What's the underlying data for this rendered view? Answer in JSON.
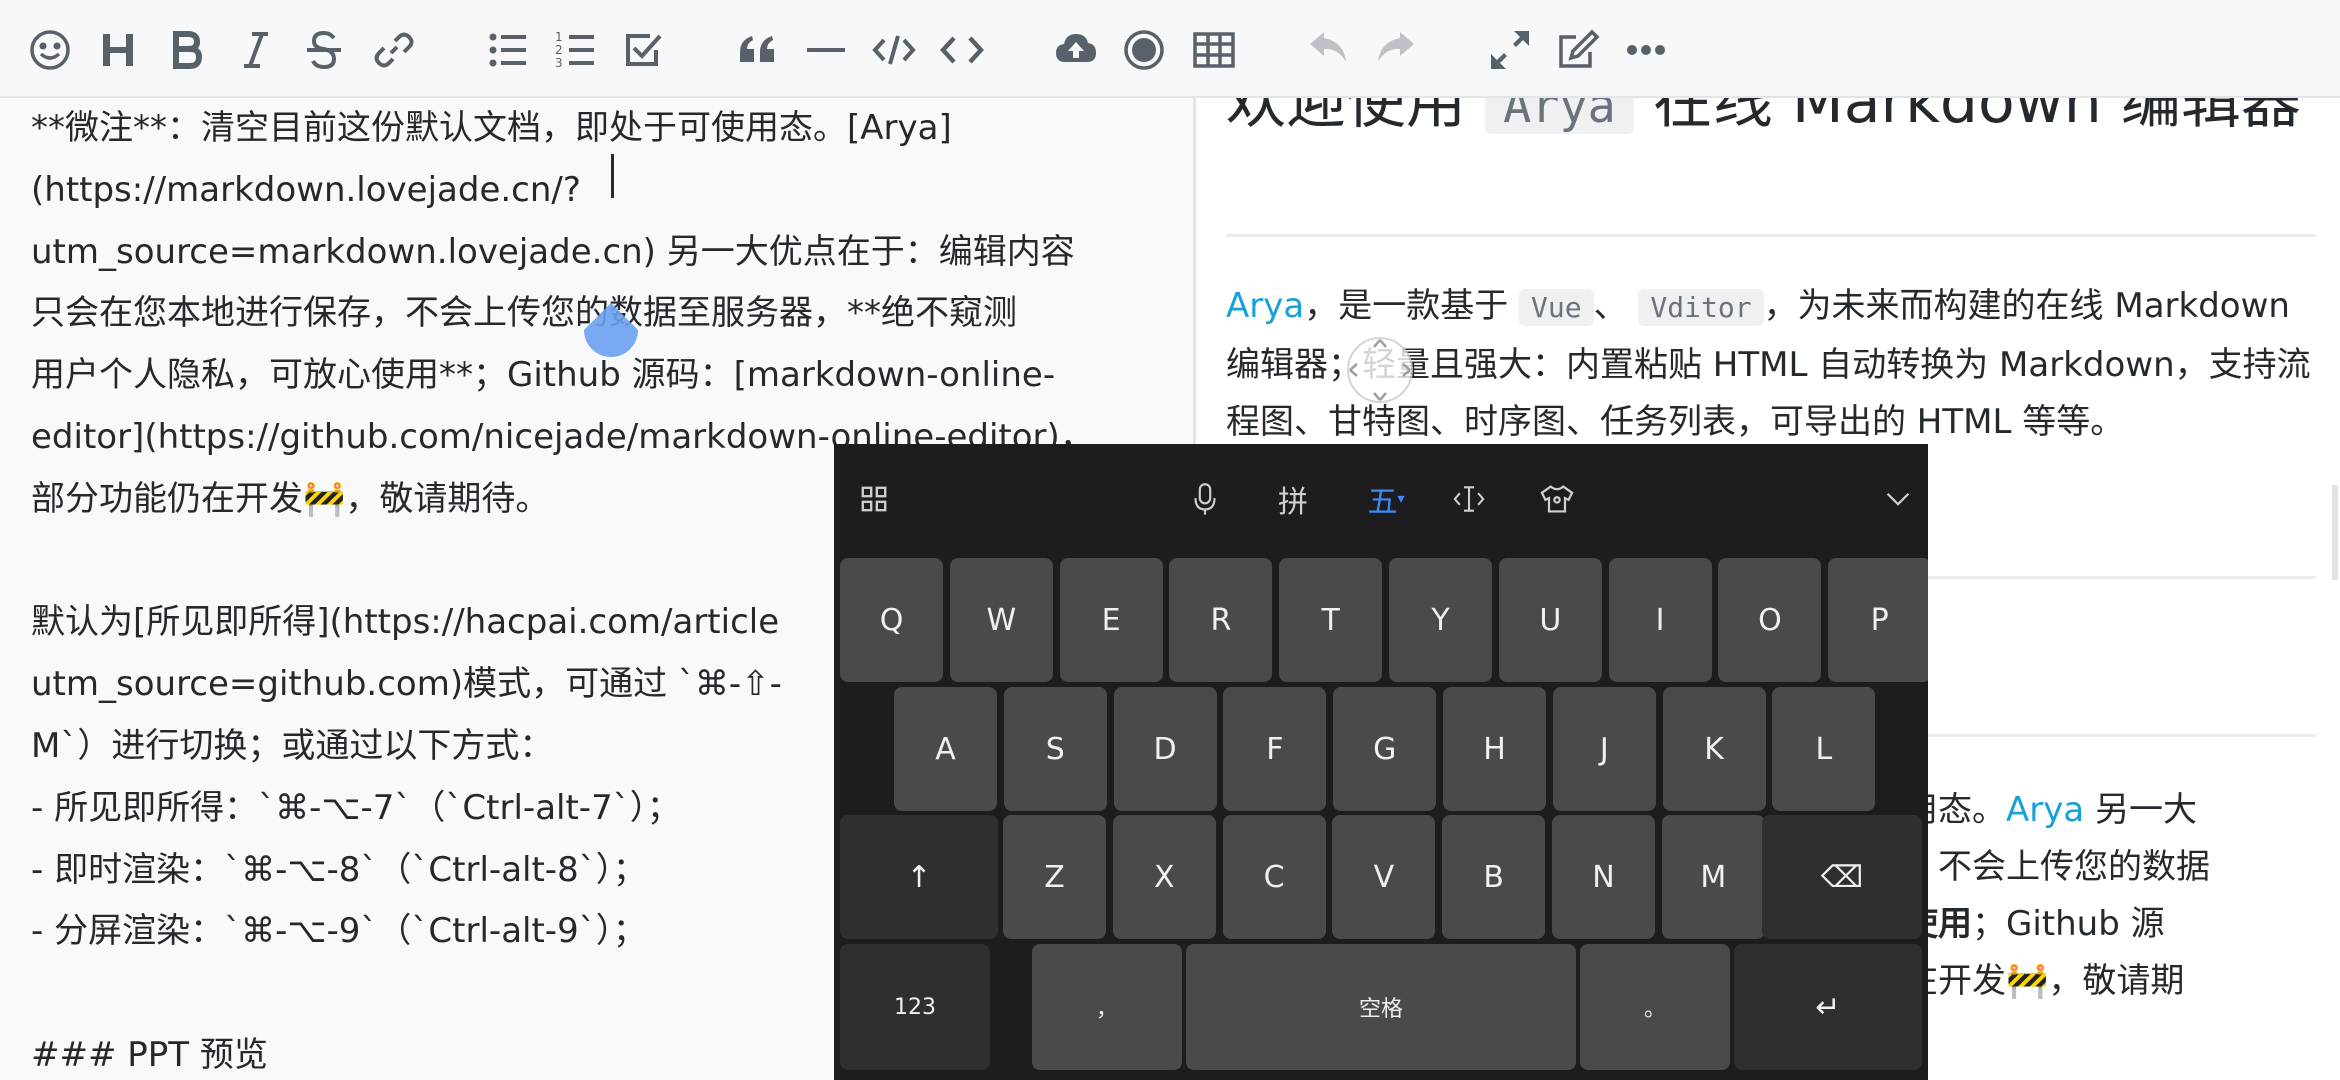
{
  "toolbar": {
    "buttons": [
      {
        "icon": "emoji-icon"
      },
      {
        "icon": "heading-icon"
      },
      {
        "icon": "bold-icon"
      },
      {
        "icon": "italic-icon"
      },
      {
        "icon": "strike-icon"
      },
      {
        "icon": "link-icon"
      },
      {
        "icon": "bullet-list-icon"
      },
      {
        "icon": "ordered-list-icon"
      },
      {
        "icon": "check-list-icon"
      },
      {
        "icon": "quote-icon"
      },
      {
        "icon": "line-icon"
      },
      {
        "icon": "inline-code-icon"
      },
      {
        "icon": "code-block-icon"
      },
      {
        "icon": "upload-icon"
      },
      {
        "icon": "record-icon"
      },
      {
        "icon": "table-icon"
      },
      {
        "icon": "undo-icon"
      },
      {
        "icon": "redo-icon"
      },
      {
        "icon": "fullscreen-icon"
      },
      {
        "icon": "edit-mode-icon"
      },
      {
        "icon": "more-icon"
      }
    ]
  },
  "editor": {
    "lines": [
      "**微注**：清空目前这份默认文档，即处于可使用态。[Arya]",
      "(https://markdown.lovejade.cn/?",
      "utm_source=markdown.lovejade.cn) 另一大优点在于：编辑内容",
      "只会在您本地进行保存，不会上传您的数据至服务器，**绝不窥测",
      "用户个人隐私，可放心使用**；Github 源码：[markdown-online-",
      "editor](https://github.com/nicejade/markdown-online-editor)，",
      "部分功能仍在开发🚧，敬请期待。",
      "",
      "默认为[所见即所得](https://hacpai.com/article",
      "utm_source=github.com)模式，可通过 `⌘-⇧-",
      "M`）进行切换；或通过以下方式：",
      "- 所见即所得：`⌘-⌥-7`（`Ctrl-alt-7`）；",
      "- 即时渲染：`⌘-⌥-8`（`Ctrl-alt-8`）；",
      "- 分屏渲染：`⌘-⌥-9`（`Ctrl-alt-9`）；",
      "",
      "### PPT 预览"
    ]
  },
  "preview": {
    "heading": {
      "pre": "欢迎使用",
      "code": "Arya",
      "post": "在线 Markdown 编辑器"
    },
    "para1": {
      "link": "Arya",
      "t1": "，是一款基于",
      "code1": "Vue",
      "t2": "、",
      "code2": "Vditor",
      "t3": "，为未来而构建的在线 Markdown 编辑器；轻量且强大：内置粘贴 HTML 自动转换为 Markdown，支持流程图、甘特图、时序图、任务列表，可导出",
      "t4": "的 HTML 等等。"
    },
    "para2": {
      "line1": "使用态。",
      "link": "Arya",
      "line1b": "另一大",
      "line2": "存，不会上传您的数据",
      "line3a": "心使用",
      "line3b": "；Github 源",
      "line4": "仍在开发🚧，敬请期"
    }
  },
  "keyboard": {
    "toolbar": {
      "grid": "apps-grid-icon",
      "mic": "microphone-icon",
      "pinyin": "拼",
      "wubi": "五",
      "cursor": "cursor-move-icon",
      "skin": "skin-icon",
      "collapse": "collapse-icon"
    },
    "row1": [
      "Q",
      "W",
      "E",
      "R",
      "T",
      "Y",
      "U",
      "I",
      "O",
      "P"
    ],
    "row2": [
      "A",
      "S",
      "D",
      "F",
      "G",
      "H",
      "J",
      "K",
      "L"
    ],
    "row3": [
      "Z",
      "X",
      "C",
      "V",
      "B",
      "N",
      "M"
    ],
    "shift": "↑",
    "delete": "⌫",
    "num": "123",
    "comma": "，",
    "space": "空格",
    "period": "。",
    "enter": "↵"
  },
  "colors": {
    "accent": "#18a0d8",
    "keyboard_bg": "#1d1d1f",
    "key_bg": "#4a4a4c",
    "keyboard_active": "#3d8af7"
  }
}
